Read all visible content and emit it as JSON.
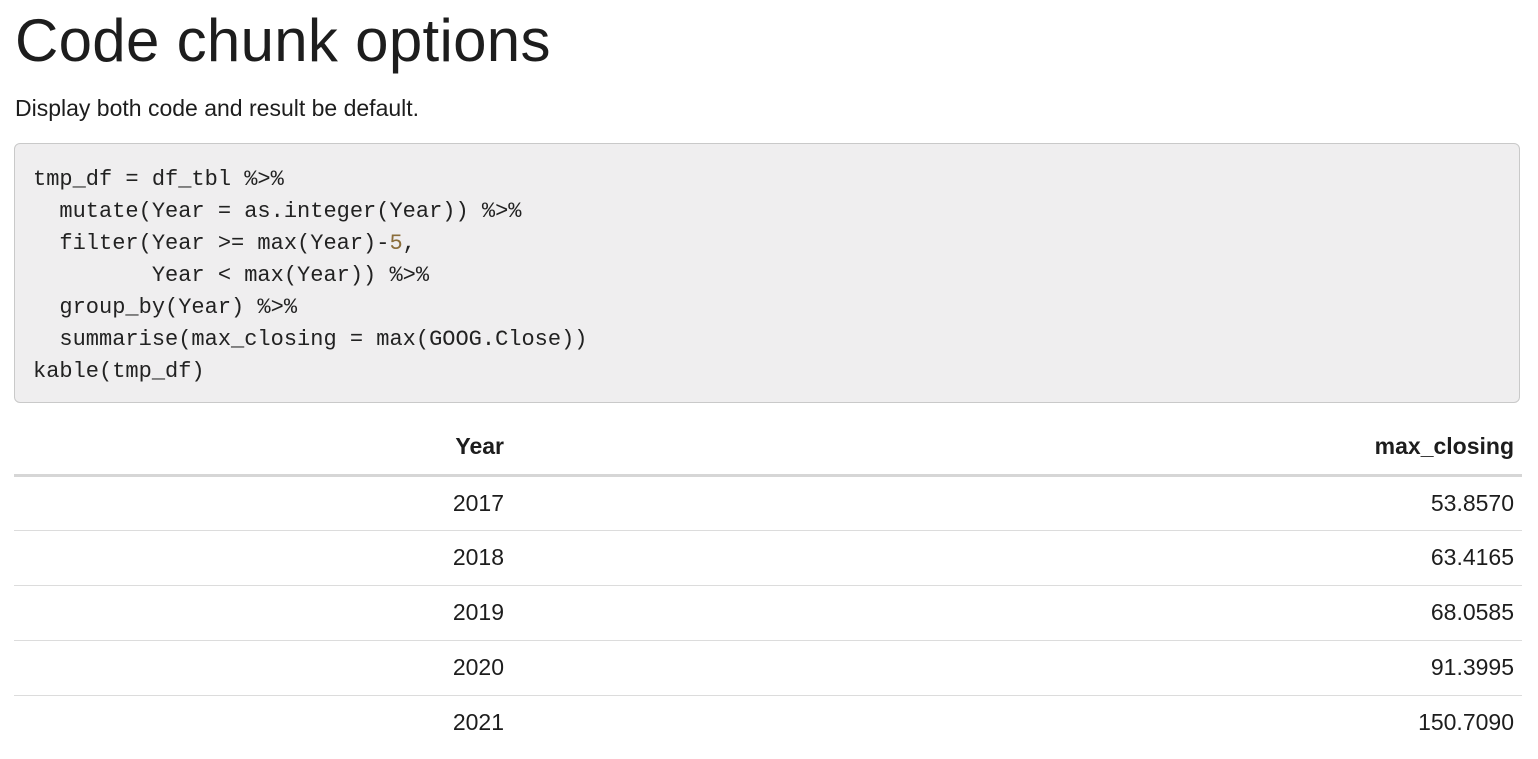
{
  "heading": "Code chunk options",
  "intro": "Display both code and result be default.",
  "code": {
    "lines": [
      "tmp_df = df_tbl %>%",
      "  mutate(Year = as.integer(Year)) %>%",
      "  filter(Year >= max(Year)-",
      "         Year < max(Year)) %>%",
      "  group_by(Year) %>%",
      "  summarise(max_closing = max(GOOG.Close))",
      "kable(tmp_df)"
    ],
    "line3_number": "5",
    "line3_suffix": ","
  },
  "table": {
    "headers": [
      "Year",
      "max_closing"
    ],
    "rows": [
      [
        "2017",
        "53.8570"
      ],
      [
        "2018",
        "63.4165"
      ],
      [
        "2019",
        "68.0585"
      ],
      [
        "2020",
        "91.3995"
      ],
      [
        "2021",
        "150.7090"
      ]
    ]
  }
}
